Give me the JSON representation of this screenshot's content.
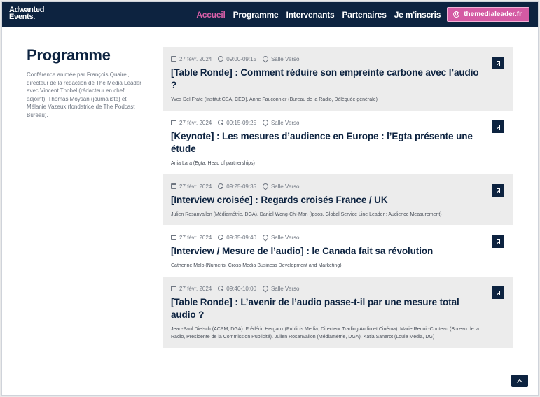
{
  "brand": {
    "line1": "Adwanted",
    "line2": "Events."
  },
  "nav": {
    "items": [
      {
        "label": "Accueil",
        "active": true
      },
      {
        "label": "Programme",
        "active": false
      },
      {
        "label": "Intervenants",
        "active": false
      },
      {
        "label": "Partenaires",
        "active": false
      },
      {
        "label": "Je m'inscris",
        "active": false
      }
    ],
    "cta": "themedialeader.fr"
  },
  "sidebar": {
    "title": "Programme",
    "description": "Conférence animée par François Quairel, directeur de la rédaction de The Media Leader avec Vincent Thobel (rédacteur en chef adjoint), Thomas Moysan (journaliste) et Mélanie Vazeux (fondatrice de The Podcast Bureau)."
  },
  "sessions": [
    {
      "date": "27 févr. 2024",
      "time": "09:00-09:15",
      "room": "Salle Verso",
      "tag": "[Table Ronde]",
      "title": " : Comment réduire son empreinte carbone avec l’audio ?",
      "speakers": "Yves Del Frate (Institut CSA, CEO). Anne Fauconnier (Bureau de la Radio, Déléguée générale)"
    },
    {
      "date": "27 févr. 2024",
      "time": "09:15-09:25",
      "room": "Salle Verso",
      "tag": "[Keynote]",
      "title": " : Les mesures d’audience en Europe : l’Egta présente une étude",
      "speakers": "Ania Lara (Egta, Head of partnerships)"
    },
    {
      "date": "27 févr. 2024",
      "time": "09:25-09:35",
      "room": "Salle Verso",
      "tag": "[Interview croisée]",
      "title": " : Regards croisés France / UK",
      "speakers": "Julien Rosanvallon (Médiamétrie, DGA). Daniel Wong-Chi-Man (Ipsos, Global Service Line Leader : Audience Measurement)"
    },
    {
      "date": "27 févr. 2024",
      "time": "09:35-09:40",
      "room": "Salle Verso",
      "tag": "[Interview / Mesure de l’audio]",
      "title": " : le Canada fait sa révolution",
      "speakers": "Catherine Malo (Numeris, Cross-Media Business Development and Marketing)"
    },
    {
      "date": "27 févr. 2024",
      "time": "09:40-10:00",
      "room": "Salle Verso",
      "tag": "[Table Ronde]",
      "title": " : L’avenir de l’audio passe-t-il par une mesure total audio ?",
      "speakers": "Jean-Paul Dietsch (ACPM, DGA). Frédéric Hergaux (Publicis Media, Directeur Trading Audio et Cinéma). Marie Renoir-Couteau (Bureau de la Radio, Présidente de la Commission Publicité). Julien Rosanvallon (Médiamétrie, DGA). Katia Sanerot (Louie Media, DG)"
    }
  ],
  "colors": {
    "navy": "#0d2340",
    "pink": "#d45aa3",
    "alt_row": "#ececec"
  }
}
